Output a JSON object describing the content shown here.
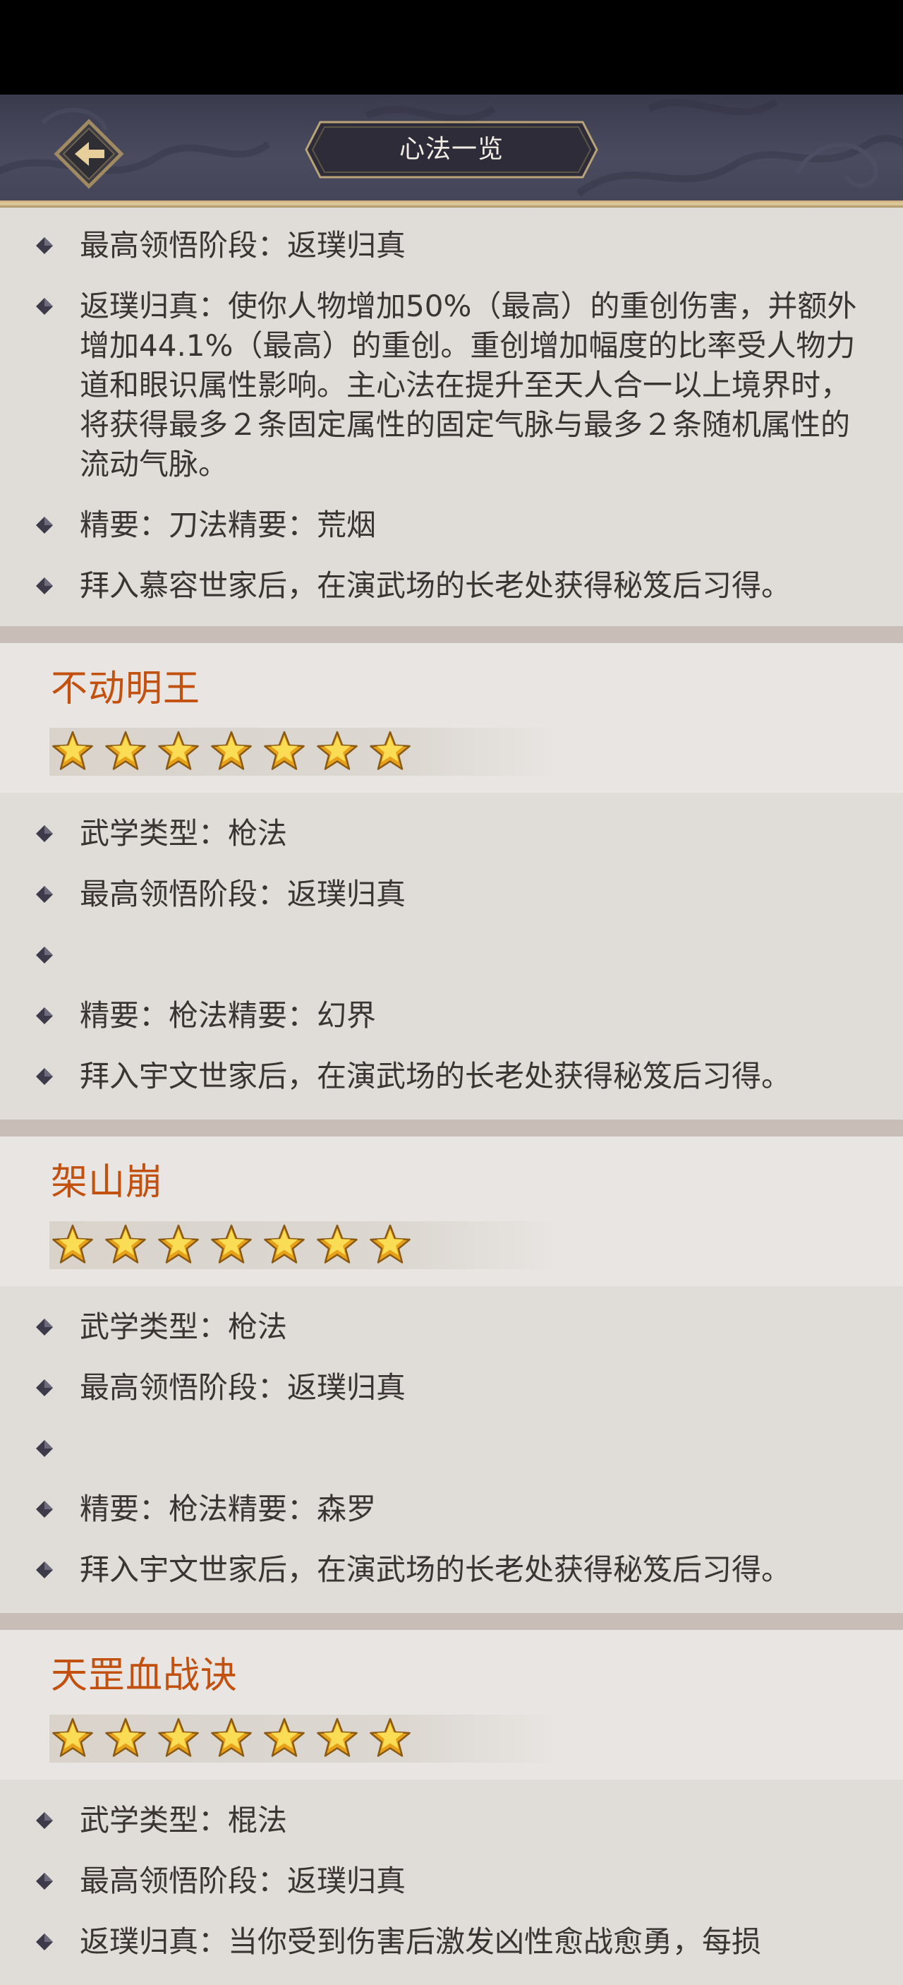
{
  "header": {
    "title": "心法一览"
  },
  "top_partial": {
    "rows": [
      {
        "text": "最高领悟阶段：返璞归真"
      },
      {
        "text": "返璞归真：使你人物增加50%（最高）的重创伤害，并额外增加44.1%（最高）的重创。重创增加幅度的比率受人物力道和眼识属性影响。主心法在提升至天人合一以上境界时，将获得最多２条固定属性的固定气脉与最多２条随机属性的流动气脉。"
      },
      {
        "text": "精要：刀法精要：荒烟"
      },
      {
        "text": "拜入慕容世家后，在演武场的长老处获得秘笈后习得。"
      }
    ]
  },
  "skills": [
    {
      "name": "不动明王",
      "stars": 7,
      "rows": [
        {
          "text": "武学类型：枪法"
        },
        {
          "text": "最高领悟阶段：返璞归真"
        },
        {
          "text": ""
        },
        {
          "text": "精要：枪法精要：幻界"
        },
        {
          "text": "拜入宇文世家后，在演武场的长老处获得秘笈后习得。"
        }
      ]
    },
    {
      "name": "架山崩",
      "stars": 7,
      "rows": [
        {
          "text": "武学类型：枪法"
        },
        {
          "text": "最高领悟阶段：返璞归真"
        },
        {
          "text": ""
        },
        {
          "text": "精要：枪法精要：森罗"
        },
        {
          "text": "拜入宇文世家后，在演武场的长老处获得秘笈后习得。"
        }
      ]
    },
    {
      "name": "天罡血战诀",
      "stars": 7,
      "rows": [
        {
          "text": "武学类型：棍法"
        },
        {
          "text": "最高领悟阶段：返璞归真"
        },
        {
          "text": "返璞归真：当你受到伤害后激发凶性愈战愈勇，每损"
        }
      ]
    }
  ],
  "colors": {
    "skill_name": "#c2500f",
    "title_text": "#f2ede4",
    "topbar": "#44455a",
    "gold_rule": "#d8c08f"
  },
  "icons": {
    "back": "arrow-left-icon",
    "bullet": "diamond-bullet-icon",
    "star": "star-icon"
  }
}
